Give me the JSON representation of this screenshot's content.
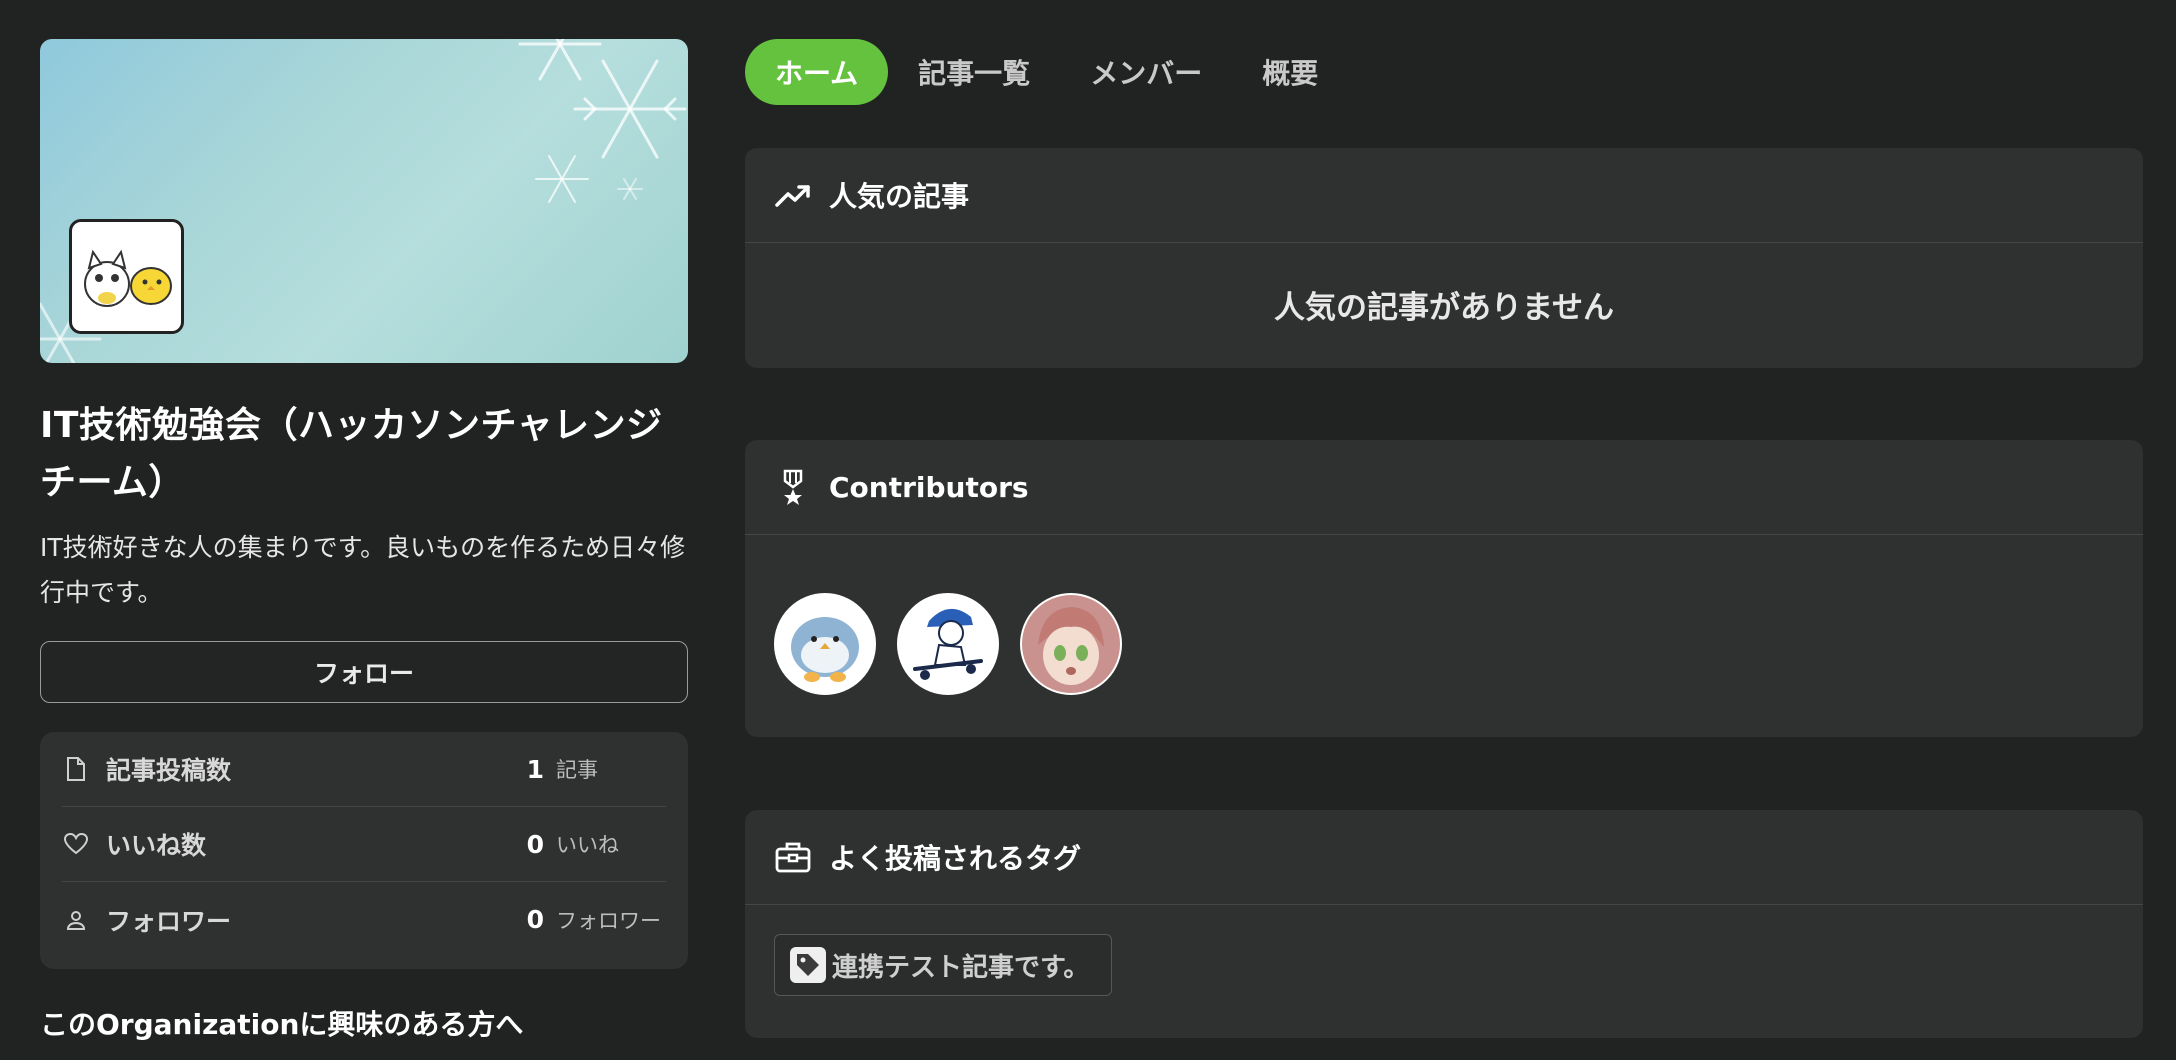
{
  "org": {
    "title": "IT技術勉強会（ハッカソンチャレンジチーム）",
    "description": "IT技術好きな人の集まりです。良いものを作るため日々修行中です。",
    "follow_label": "フォロー"
  },
  "stats": [
    {
      "icon": "document-icon",
      "label": "記事投稿数",
      "value": "1",
      "unit": "記事"
    },
    {
      "icon": "heart-icon",
      "label": "いいね数",
      "value": "0",
      "unit": "いいね"
    },
    {
      "icon": "person-icon",
      "label": "フォロワー",
      "value": "0",
      "unit": "フォロワー"
    }
  ],
  "interest_heading": "このOrganizationに興味のある方へ",
  "tabs": [
    {
      "label": "ホーム",
      "active": true
    },
    {
      "label": "記事一覧",
      "active": false
    },
    {
      "label": "メンバー",
      "active": false
    },
    {
      "label": "概要",
      "active": false
    }
  ],
  "popular": {
    "title": "人気の記事",
    "icon": "trending-up-icon",
    "empty_message": "人気の記事がありません"
  },
  "contributors": {
    "title": "Contributors",
    "icon": "medal-icon",
    "avatars": [
      "penguin-avatar",
      "skater-avatar",
      "anime-girl-avatar"
    ]
  },
  "tags": {
    "title": "よく投稿されるタグ",
    "icon": "briefcase-icon",
    "items": [
      "連携テスト記事です。"
    ]
  },
  "colors": {
    "background": "#212222",
    "card": "#2f3030",
    "accent": "#65c23e"
  }
}
